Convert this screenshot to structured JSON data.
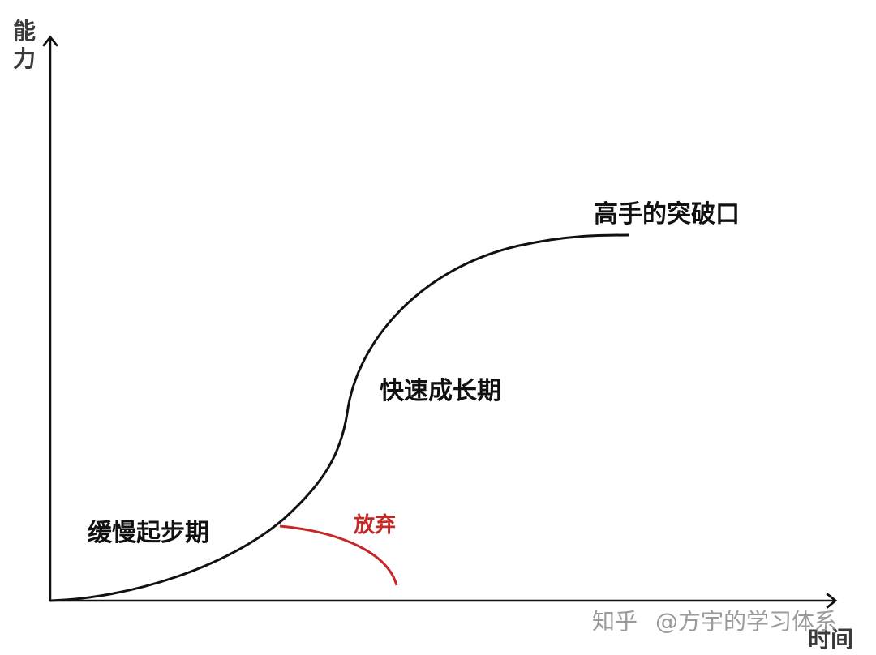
{
  "diagram": {
    "y_axis_label": "能力",
    "x_axis_label": "时间",
    "stages": {
      "slow_start": "缓慢起步期",
      "rapid_growth": "快速成长期",
      "breakthrough": "高手的突破口"
    },
    "give_up_label": "放弃",
    "watermark": {
      "site": "知乎",
      "author": "@方宇的学习体系"
    },
    "colors": {
      "curve": "#111111",
      "axis": "#111111",
      "give_up": "#c62828",
      "watermark": "#9a9a9a"
    }
  }
}
